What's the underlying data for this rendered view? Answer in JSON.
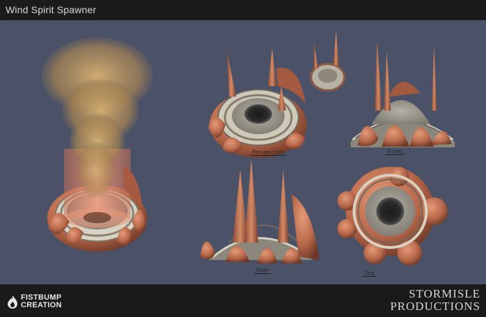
{
  "window": {
    "title": "Wind Spirit Spawner"
  },
  "views": {
    "perspective_label": "Perspective",
    "front_label": "Front",
    "side_label": "Side",
    "top_label": "Top"
  },
  "branding": {
    "left_line1": "FISTBUMP",
    "left_line2": "CREATION",
    "right_line1": "STORMISLE",
    "right_line2": "PRODUCTIONS"
  },
  "colors": {
    "background": "#4b5268",
    "copper": "#b8684a",
    "copper_dark": "#7a3f2c",
    "stone": "#9a968c",
    "sand": "#c9a366"
  }
}
